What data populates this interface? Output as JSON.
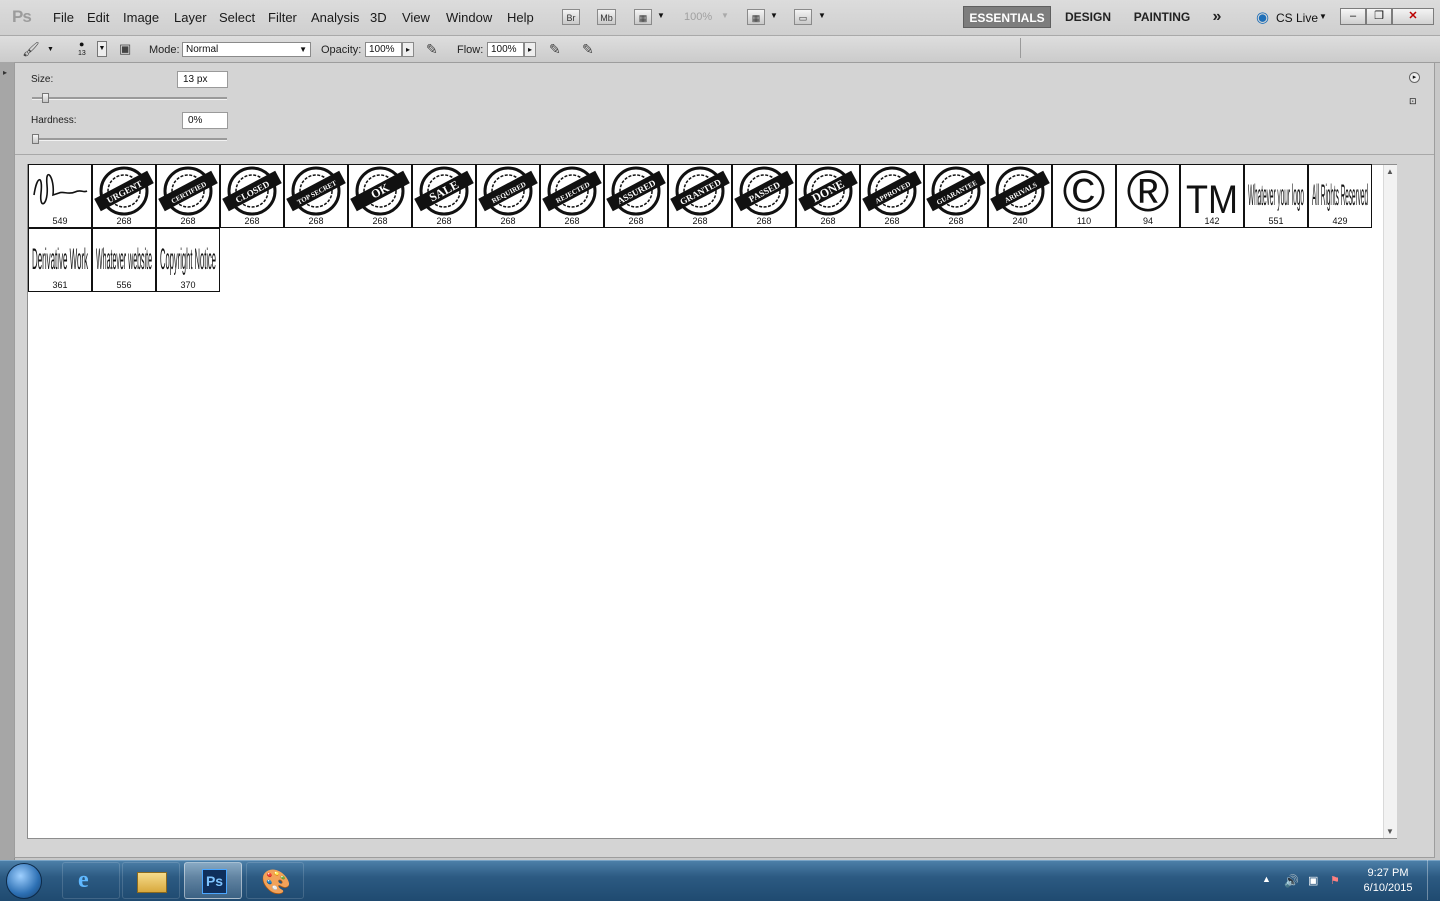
{
  "app": {
    "logo_text": "Ps"
  },
  "menu": [
    "File",
    "Edit",
    "Image",
    "Layer",
    "Select",
    "Filter",
    "Analysis",
    "3D",
    "View",
    "Window",
    "Help"
  ],
  "appbar": {
    "bridge": "Br",
    "minibridge": "Mb",
    "zoom": "100%"
  },
  "workspaces": {
    "essentials": "ESSENTIALS",
    "design": "DESIGN",
    "painting": "PAINTING",
    "more": "»",
    "cslive": "CS Live"
  },
  "options": {
    "mode_label": "Mode:",
    "mode_value": "Normal",
    "opacity_label": "Opacity:",
    "opacity_value": "100%",
    "flow_label": "Flow:",
    "flow_value": "100%",
    "brush_size_small": "13"
  },
  "brush_panel": {
    "size_label": "Size:",
    "size_value": "13 px",
    "size_fraction": 0.05,
    "hardness_label": "Hardness:",
    "hardness_value": "0%",
    "hardness_fraction": 0.0
  },
  "brushes": [
    {
      "art": "signature",
      "text": "",
      "size": "549"
    },
    {
      "art": "stamp",
      "text": "URGENT",
      "size": "268"
    },
    {
      "art": "stamp",
      "text": "CERTIFIED",
      "size": "268"
    },
    {
      "art": "stamp",
      "text": "CLOSED",
      "size": "268"
    },
    {
      "art": "stamp",
      "text": "TOP SECRET",
      "size": "268"
    },
    {
      "art": "stamp",
      "text": "OK",
      "size": "268"
    },
    {
      "art": "stamp",
      "text": "SALE",
      "size": "268"
    },
    {
      "art": "stamp",
      "text": "REQUIRED",
      "size": "268"
    },
    {
      "art": "stamp",
      "text": "REJECTED",
      "size": "268"
    },
    {
      "art": "stamp",
      "text": "ASSURED",
      "size": "268"
    },
    {
      "art": "stamp",
      "text": "GRANTED",
      "size": "268"
    },
    {
      "art": "stamp",
      "text": "PASSED",
      "size": "268"
    },
    {
      "art": "stamp",
      "text": "DONE",
      "size": "268"
    },
    {
      "art": "stamp",
      "text": "APPROVED",
      "size": "268"
    },
    {
      "art": "stamp",
      "text": "GUARANTEE",
      "size": "268"
    },
    {
      "art": "stamp",
      "text": "ARRIVALS",
      "size": "240"
    },
    {
      "art": "symbol",
      "text": "©",
      "size": "110"
    },
    {
      "art": "symbol",
      "text": "®",
      "size": "94"
    },
    {
      "art": "symbol",
      "text": "TM",
      "size": "142"
    },
    {
      "art": "tall",
      "text": "Whatever your logo",
      "size": "551"
    },
    {
      "art": "tall",
      "text": "All Rights Reserved",
      "size": "429"
    },
    {
      "art": "tall",
      "text": "Derivative Work",
      "size": "361"
    },
    {
      "art": "tall",
      "text": "Whatever website",
      "size": "556"
    },
    {
      "art": "tall",
      "text": "Copyright Notice",
      "size": "370"
    }
  ],
  "taskbar": {
    "time": "9:27 PM",
    "date": "6/10/2015",
    "ps_icon_label": "Ps"
  },
  "colors": {
    "accent": "#7d7d7d",
    "taskbar": "#2c5a82",
    "panel": "#d4d4d4"
  }
}
